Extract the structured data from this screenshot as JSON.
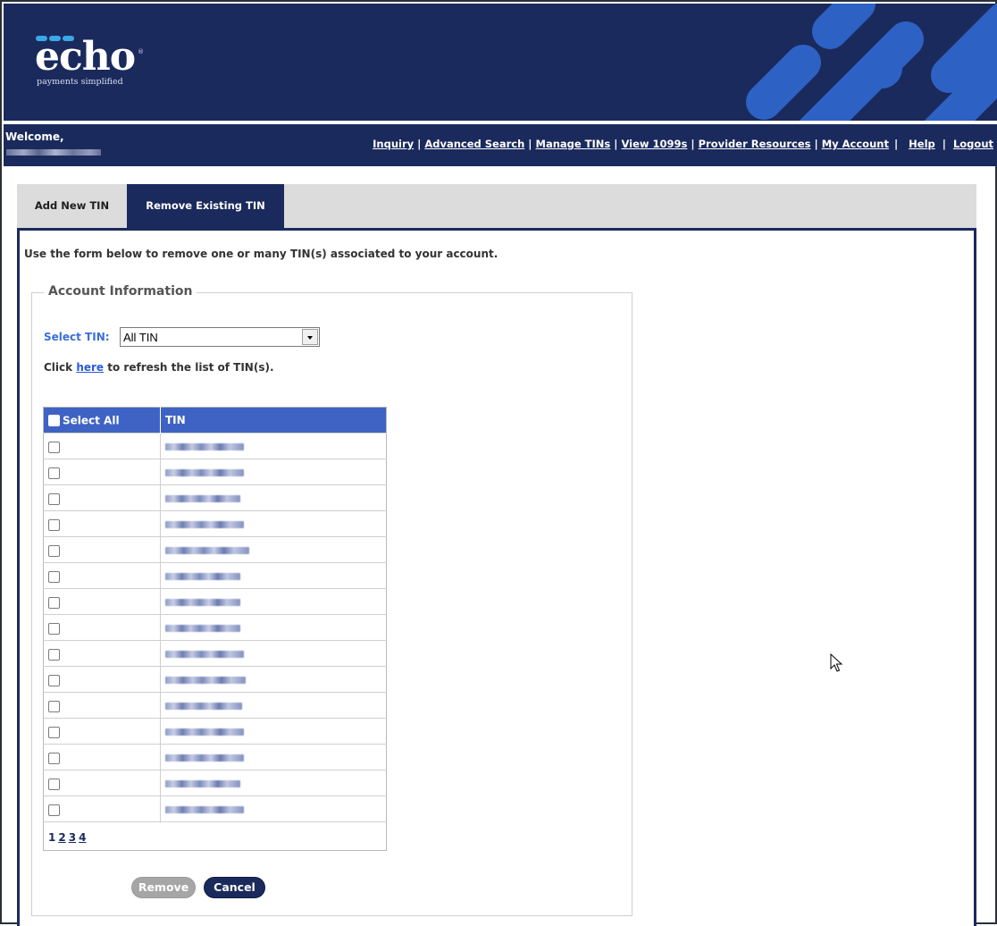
{
  "header": {
    "logo_text": "echo",
    "logo_tm": "®",
    "logo_tagline": "payments simplified"
  },
  "nav": {
    "welcome": "Welcome,",
    "links": [
      "Inquiry",
      "Advanced Search",
      "Manage TINs",
      "View 1099s",
      "Provider Resources",
      "My Account",
      "Help",
      "Logout"
    ],
    "separator": "|"
  },
  "tabs": [
    {
      "label": "Add New TIN",
      "active": false
    },
    {
      "label": "Remove Existing TIN",
      "active": true
    }
  ],
  "form": {
    "intro": "Use the form below to remove one or many TIN(s) associated to your account.",
    "legend": "Account Information",
    "select_label": "Select TIN:",
    "select_value": "All TIN",
    "refresh_prefix": "Click",
    "refresh_link": "here",
    "refresh_suffix": "to refresh the list of TIN(s)."
  },
  "table": {
    "headers": [
      "Select All",
      "TIN"
    ],
    "row_count": 15,
    "rows_redacted": true,
    "pages": [
      "1",
      "2",
      "3",
      "4"
    ],
    "current_page": "1"
  },
  "buttons": {
    "remove": "Remove",
    "cancel": "Cancel"
  },
  "colors": {
    "brand_navy": "#1b2a5c",
    "header_stripe_blue": "#2d62c4",
    "table_header_blue": "#3f63c4",
    "label_blue": "#3a6fd8",
    "button_disabled": "#a6a6a6"
  }
}
